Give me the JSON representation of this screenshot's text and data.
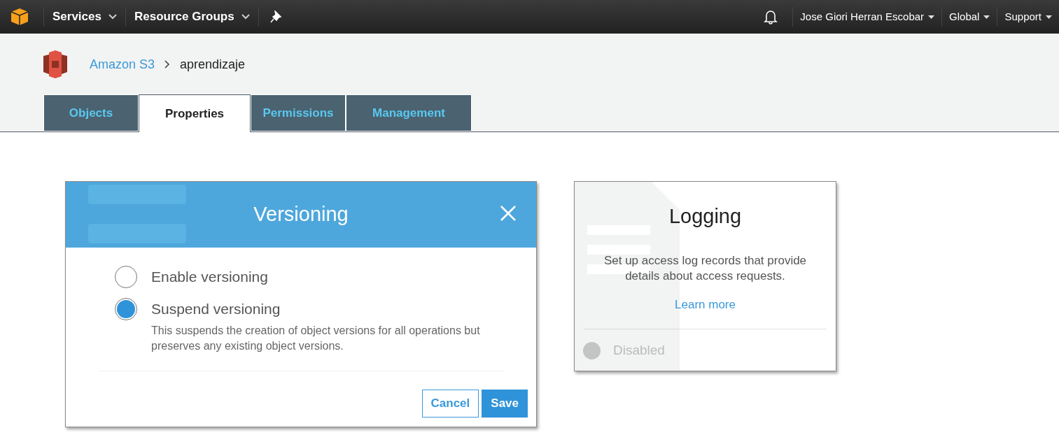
{
  "navbar": {
    "menus": [
      {
        "label": "Services",
        "kind": "chevron"
      },
      {
        "label": "Resource Groups",
        "kind": "chevron"
      }
    ],
    "right_menus": [
      {
        "label": "Jose Giori Herran Escobar"
      },
      {
        "label": "Global"
      },
      {
        "label": "Support"
      }
    ]
  },
  "breadcrumb": [
    {
      "label": "Amazon S3",
      "link": true
    },
    {
      "label": "aprendizaje",
      "link": false
    }
  ],
  "tabs": [
    {
      "label": "Objects",
      "selected": false
    },
    {
      "label": "Properties",
      "selected": true
    },
    {
      "label": "Permissions",
      "selected": false
    },
    {
      "label": "Management",
      "selected": false
    }
  ],
  "versioning": {
    "title": "Versioning",
    "options": [
      {
        "label": "Enable versioning",
        "selected": false
      },
      {
        "label": "Suspend versioning",
        "selected": true,
        "description": "This suspends the creation of object versions for all operations but preserves any existing object versions."
      }
    ],
    "buttons": [
      {
        "label": "Cancel",
        "kind": "outline"
      },
      {
        "label": "Save",
        "kind": "primary"
      }
    ]
  },
  "logging": {
    "title": "Logging",
    "description": "Set up access log records that provide details about access requests.",
    "link": "Learn more",
    "status": {
      "label": "Disabled",
      "enabled": false
    }
  }
}
